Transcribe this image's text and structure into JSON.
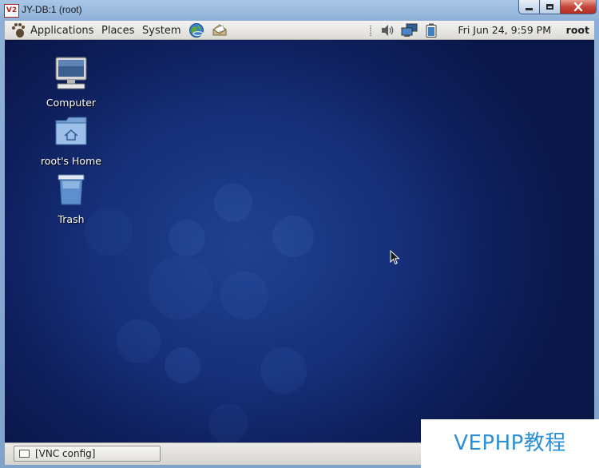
{
  "window": {
    "title": "JY-DB:1 (root)",
    "logo_text": "V2"
  },
  "top_panel": {
    "menus": [
      "Applications",
      "Places",
      "System"
    ],
    "clock": "Fri Jun 24,  9:59 PM",
    "user": "root",
    "launchers": [
      "web-browser-icon",
      "email-client-icon"
    ],
    "tray": [
      "volume-icon",
      "network-icon",
      "battery-icon"
    ]
  },
  "desktop": {
    "icons": [
      {
        "label": "Computer",
        "icon": "computer-icon"
      },
      {
        "label": "root's Home",
        "icon": "home-folder-icon"
      },
      {
        "label": "Trash",
        "icon": "trash-icon"
      }
    ]
  },
  "bottom_panel": {
    "tasks": [
      {
        "label": "[VNC config]"
      }
    ]
  },
  "watermark": "VEPHP教程",
  "colors": {
    "desktop_background": "#16307a",
    "panel": "#e6e4e0",
    "watermark_text": "#2b8fd6"
  }
}
